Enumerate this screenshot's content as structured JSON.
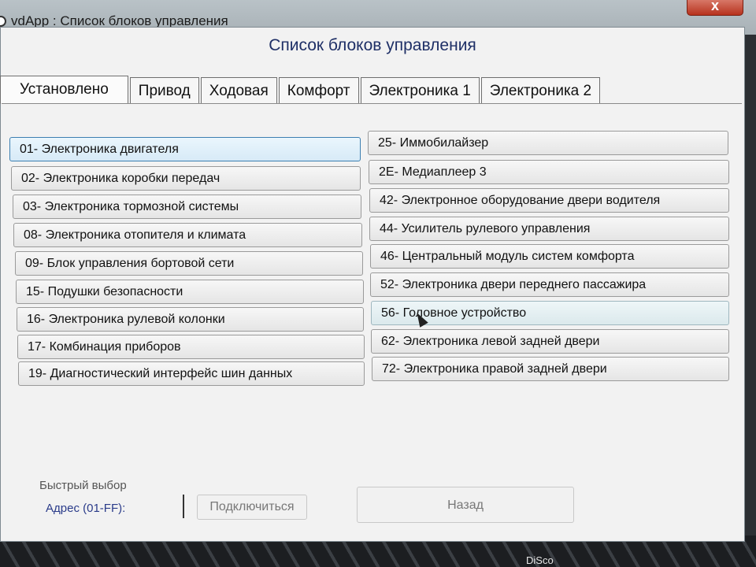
{
  "window": {
    "title": "vdApp : Список блоков управления",
    "close_label": "x"
  },
  "heading": "Список блоков управления",
  "tabs": [
    {
      "label": "Установлено",
      "active": true
    },
    {
      "label": "Привод"
    },
    {
      "label": "Ходовая"
    },
    {
      "label": "Комфорт"
    },
    {
      "label": "Электроника 1"
    },
    {
      "label": "Электроника 2"
    }
  ],
  "left_column": [
    {
      "label": "01- Электроника двигателя",
      "state": "selected"
    },
    {
      "label": "02- Электроника коробки передач"
    },
    {
      "label": "03- Электроника тормозной системы"
    },
    {
      "label": "08- Электроника отопителя и климата"
    },
    {
      "label": "09- Блок управления бортовой сети"
    },
    {
      "label": "15- Подушки безопасности"
    },
    {
      "label": "16- Электроника рулевой колонки"
    },
    {
      "label": "17- Комбинация приборов"
    },
    {
      "label": "19- Диагностический интерфейс шин данных"
    }
  ],
  "right_column": [
    {
      "label": "25- Иммобилайзер"
    },
    {
      "label": "2E- Медиаплеер 3"
    },
    {
      "label": "42- Электронное оборудование двери водителя"
    },
    {
      "label": "44- Усилитель рулевого управления"
    },
    {
      "label": "46- Центральный модуль систем комфорта"
    },
    {
      "label": "52- Электроника двери переднего пассажира"
    },
    {
      "label": "56- Головное устройство",
      "state": "hover"
    },
    {
      "label": "62- Электроника левой задней двери"
    },
    {
      "label": "72- Электроника правой задней двери"
    }
  ],
  "quick_select": {
    "title": "Быстрый выбор",
    "address_label": "Адрес (01-FF):",
    "address_value": "",
    "connect_label": "Подключиться"
  },
  "back_label": "Назад",
  "taskbar_text": "DiSco",
  "colors": {
    "selected_border": "#3c7fb1",
    "heading": "#1e2f66",
    "close_button": "#b7321d"
  }
}
